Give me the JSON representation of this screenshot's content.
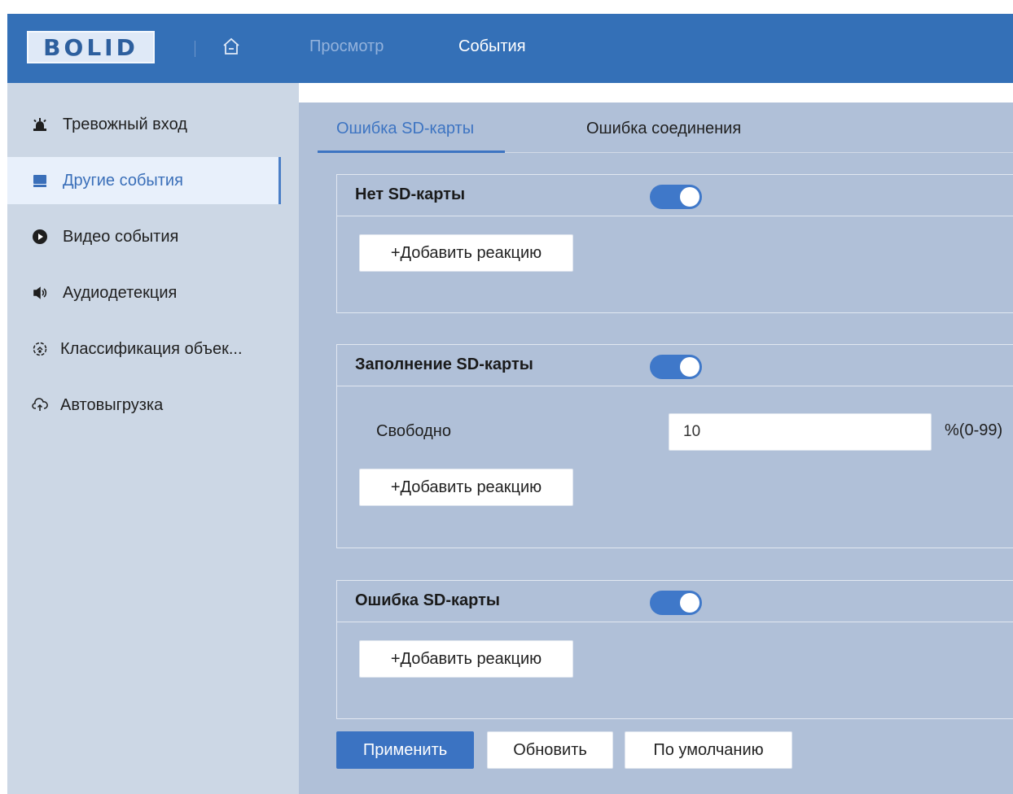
{
  "header": {
    "logo_text": "BOLID",
    "nav": [
      {
        "label": "Просмотр",
        "active": false
      },
      {
        "label": "События",
        "active": true
      }
    ],
    "icons": [
      "home-icon"
    ]
  },
  "sidebar": {
    "items": [
      {
        "label": "Тревожный вход",
        "icon": "alarm-light-icon",
        "active": false
      },
      {
        "label": "Другие события",
        "icon": "drive-icon",
        "active": true
      },
      {
        "label": "Видео события",
        "icon": "play-circle-icon",
        "active": false
      },
      {
        "label": "Аудиодетекция",
        "icon": "speaker-icon",
        "active": false
      },
      {
        "label": "Классификация объек...",
        "icon": "classify-icon",
        "active": false
      },
      {
        "label": "Автовыгрузка",
        "icon": "cloud-upload-icon",
        "active": false
      }
    ]
  },
  "tabs": [
    {
      "label": "Ошибка SD-карты",
      "active": true
    },
    {
      "label": "Ошибка соединения",
      "active": false
    }
  ],
  "panels": {
    "no_sd": {
      "title": "Нет SD-карты",
      "enabled": true,
      "add_label": "+Добавить реакцию"
    },
    "sd_full": {
      "title": "Заполнение SD-карты",
      "enabled": true,
      "free_label": "Свободно",
      "free_value": "10",
      "free_unit": "%(0-99)",
      "add_label": "+Добавить реакцию"
    },
    "sd_error": {
      "title": "Ошибка SD-карты",
      "enabled": true,
      "add_label": "+Добавить реакцию"
    }
  },
  "actions": {
    "apply": "Применить",
    "refresh": "Обновить",
    "default": "По умолчанию"
  },
  "colors": {
    "header_bg": "#3470b7",
    "accent": "#3d74c2",
    "sidebar_bg": "#ccd7e5",
    "content_bg": "#b0c0d8",
    "toggle_on": "#3f78c9"
  }
}
